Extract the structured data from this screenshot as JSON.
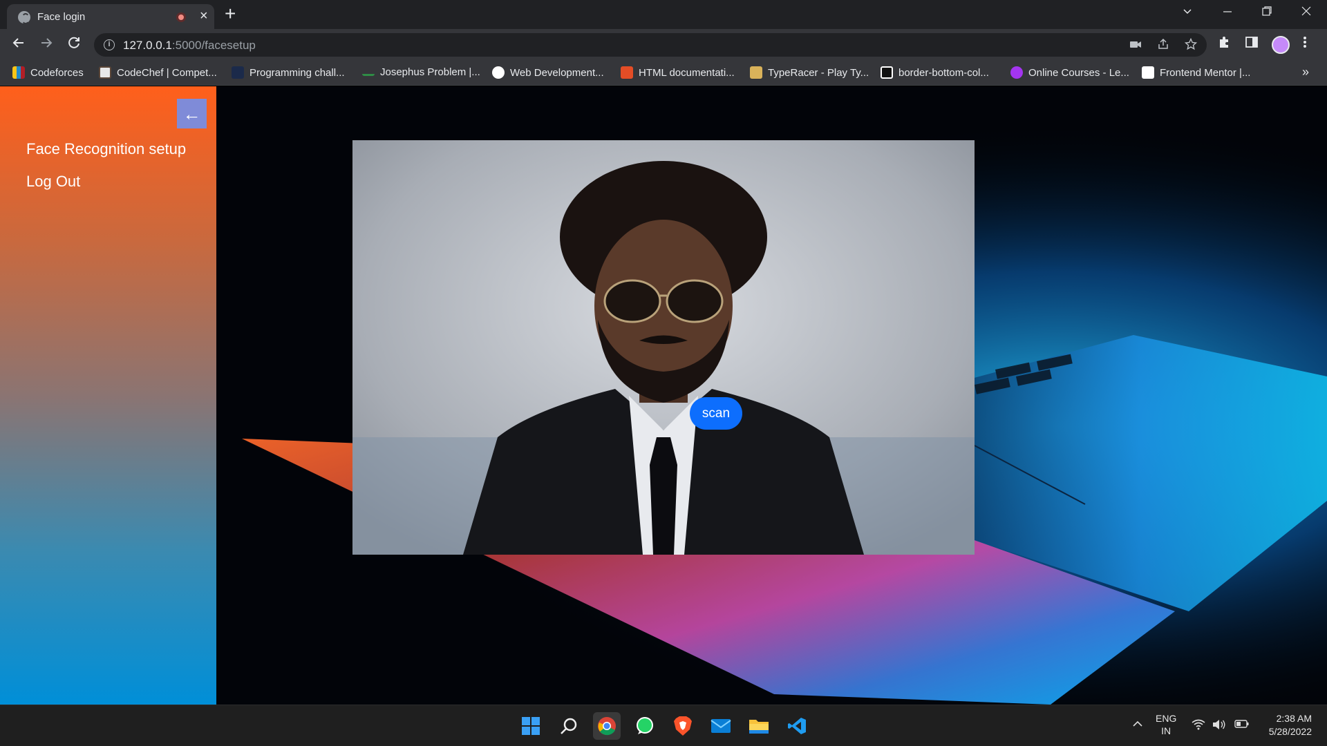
{
  "browser": {
    "tab_title": "Face login",
    "tab_close": "×",
    "new_tab": "+",
    "url_host": "127.0.0.1",
    "url_path": ":5000/facesetup",
    "bookmarks_more": "»",
    "bookmarks": [
      {
        "label": "Codeforces",
        "icon": "codeforces-icon",
        "color": "#1f8acb"
      },
      {
        "label": "CodeChef | Compet...",
        "icon": "codechef-icon",
        "color": "#e8e8e8"
      },
      {
        "label": "Programming chall...",
        "icon": "hackerrank-icon",
        "color": "#1b2a4a"
      },
      {
        "label": "Josephus Problem |...",
        "icon": "geeksforgeeks-icon",
        "color": "#2f8d46"
      },
      {
        "label": "Web Development...",
        "icon": "web-dev-icon",
        "color": "#ffffff"
      },
      {
        "label": "HTML documentati...",
        "icon": "html-doc-icon",
        "color": "#e44d26"
      },
      {
        "label": "TypeRacer - Play Ty...",
        "icon": "typeracer-icon",
        "color": "#d9b25a"
      },
      {
        "label": "border-bottom-col...",
        "icon": "codepen-icon",
        "color": "#111111"
      },
      {
        "label": "Online Courses - Le...",
        "icon": "udemy-icon",
        "color": "#a435f0"
      },
      {
        "label": "Frontend Mentor |...",
        "icon": "frontend-mentor-icon",
        "color": "#ffffff"
      }
    ]
  },
  "sidebar": {
    "back_icon": "←",
    "items": [
      {
        "label": "Face Recognition setup"
      },
      {
        "label": "Log Out"
      }
    ]
  },
  "main": {
    "scan_label": "scan"
  },
  "taskbar": {
    "lang_top": "ENG",
    "lang_bottom": "IN",
    "time": "2:38 AM",
    "date": "5/28/2022"
  },
  "colors": {
    "sidebar_top": "#ff5f1b",
    "sidebar_bottom": "#008fd8",
    "back_button": "#7f8bd8",
    "scan_button": "#0d6efd"
  }
}
